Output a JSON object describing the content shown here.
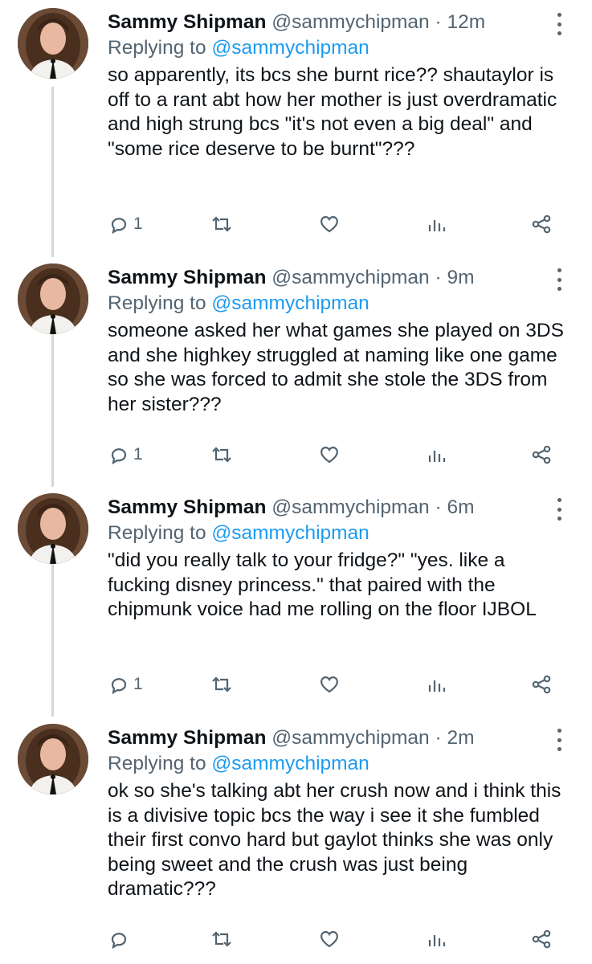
{
  "tweets": [
    {
      "name": "Sammy Shipman",
      "handle": "@sammychipman",
      "separator": "·",
      "time": "12m",
      "replying_prefix": "Replying to",
      "replying_to": "@sammychipman",
      "text": "so apparently, its bcs she burnt rice?? shautaylor is off to a rant abt how her mother is just overdramatic and high strung bcs \"it's not even a big deal\" and \"some rice deserve to be burnt\"???",
      "reply_count": "1"
    },
    {
      "name": "Sammy Shipman",
      "handle": "@sammychipman",
      "separator": "·",
      "time": "9m",
      "replying_prefix": "Replying to",
      "replying_to": "@sammychipman",
      "text": "someone asked her what games she played on 3DS and she highkey struggled at naming like one game so she was forced to admit she stole the 3DS from her sister???",
      "reply_count": "1"
    },
    {
      "name": "Sammy Shipman",
      "handle": "@sammychipman",
      "separator": "·",
      "time": "6m",
      "replying_prefix": "Replying to",
      "replying_to": "@sammychipman",
      "text": "\"did you really talk to your fridge?\" \"yes. like a fucking disney princess.\" that paired with the chipmunk voice had me rolling on the floor IJBOL",
      "reply_count": "1"
    },
    {
      "name": "Sammy Shipman",
      "handle": "@sammychipman",
      "separator": "·",
      "time": "2m",
      "replying_prefix": "Replying to",
      "replying_to": "@sammychipman",
      "text": "ok so she's talking abt her crush now and i think this is a divisive topic bcs the way i see it she fumbled their first convo hard but gaylot thinks she was only being sweet and the crush was just being dramatic???",
      "reply_count": ""
    }
  ],
  "colors": {
    "text": "#0f1419",
    "secondary": "#536471",
    "link": "#1d9bf0",
    "thread_line": "#cfd9de"
  },
  "icons": [
    "avatar",
    "more-icon",
    "reply-icon",
    "retweet-icon",
    "like-icon",
    "analytics-icon",
    "share-icon"
  ]
}
